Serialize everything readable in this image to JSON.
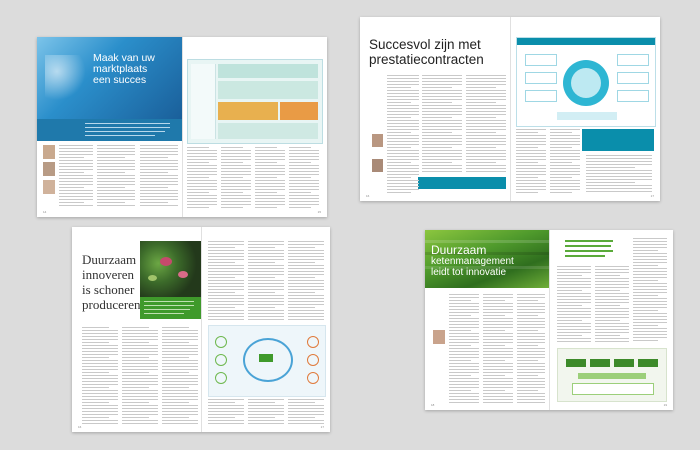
{
  "spread1": {
    "title_l1": "Maak van uw",
    "title_l2": "marktplaats",
    "title_l3": "een succes",
    "accent": "#1e86b8"
  },
  "spread2": {
    "title_l1": "Succesvol zijn met",
    "title_l2": "prestatiecontracten",
    "accent": "#0099b5"
  },
  "spread3": {
    "title_l1": "Duurzaam",
    "title_l2": "innoveren",
    "title_l3": "is schoner",
    "title_l4": "produceren",
    "accent": "#3f9a2b"
  },
  "spread4": {
    "title_l1": "Duurzaam",
    "title_l2": "ketenmanagement",
    "title_l3": "leidt tot innovatie",
    "accent": "#3f9a2b"
  }
}
